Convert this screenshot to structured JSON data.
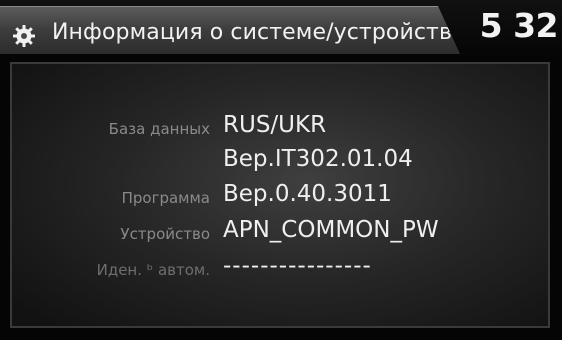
{
  "header": {
    "title": "Информация о системе/устройстве",
    "clock": "5 32",
    "icon": "gear-icon"
  },
  "info": {
    "database_label": "База данных",
    "database_value": "RUS/UKR",
    "database_version": "Вер.IT302.01.04",
    "program_label": "Программа",
    "program_value": "Вер.0.40.3011",
    "device_label": "Устройство",
    "device_value": "APN_COMMON_PW",
    "vehicle_id_label": "Иден. ᵇ автом.",
    "vehicle_id_value": "----------------"
  }
}
